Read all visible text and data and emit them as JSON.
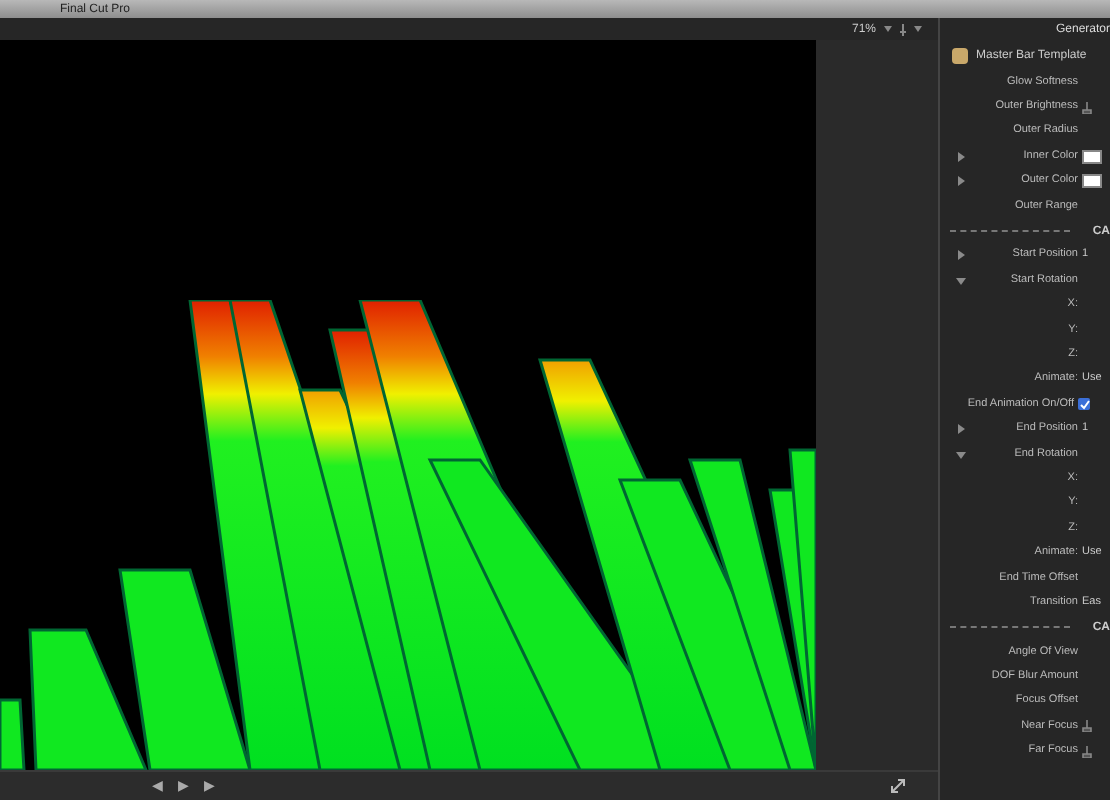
{
  "window": {
    "title": "Final Cut Pro"
  },
  "viewer": {
    "zoom": "71%",
    "transport": [
      "◀",
      "▶",
      "▶"
    ]
  },
  "inspector": {
    "title": "Generator",
    "template": "Master Bar Template",
    "rows": [
      {
        "kind": "slider",
        "label": "Glow Softness"
      },
      {
        "kind": "reset",
        "label": "Outer Brightness"
      },
      {
        "kind": "slider",
        "label": "Outer Radius"
      },
      {
        "kind": "color",
        "label": "Inner Color",
        "expanded": false,
        "color": "#ffffff"
      },
      {
        "kind": "color",
        "label": "Outer Color",
        "expanded": false,
        "color": "#ffffff"
      },
      {
        "kind": "slider",
        "label": "Outer Range"
      },
      {
        "kind": "section",
        "label": "CA"
      },
      {
        "kind": "value",
        "label": "Start Position",
        "expanded": false,
        "value": "1"
      },
      {
        "kind": "value",
        "label": "Start Rotation",
        "expanded": true
      },
      {
        "kind": "value",
        "label": "X:"
      },
      {
        "kind": "value",
        "label": "Y:"
      },
      {
        "kind": "value",
        "label": "Z:"
      },
      {
        "kind": "value",
        "label": "Animate:",
        "value": "Use"
      },
      {
        "kind": "checkbox",
        "label": "End Animation On/Off",
        "checked": true
      },
      {
        "kind": "value",
        "label": "End Position",
        "expanded": false,
        "value": "1"
      },
      {
        "kind": "value",
        "label": "End Rotation",
        "expanded": true
      },
      {
        "kind": "value",
        "label": "X:"
      },
      {
        "kind": "value",
        "label": "Y:"
      },
      {
        "kind": "value",
        "label": "Z:"
      },
      {
        "kind": "value",
        "label": "Animate:",
        "value": "Use"
      },
      {
        "kind": "slider",
        "label": "End Time Offset"
      },
      {
        "kind": "value",
        "label": "Transition",
        "value": "Eas"
      },
      {
        "kind": "section",
        "label": "CA"
      },
      {
        "kind": "slider",
        "label": "Angle Of View"
      },
      {
        "kind": "slider",
        "label": "DOF Blur Amount"
      },
      {
        "kind": "slider",
        "label": "Focus Offset"
      },
      {
        "kind": "reset",
        "label": "Near Focus"
      },
      {
        "kind": "reset",
        "label": "Far Focus"
      }
    ]
  }
}
